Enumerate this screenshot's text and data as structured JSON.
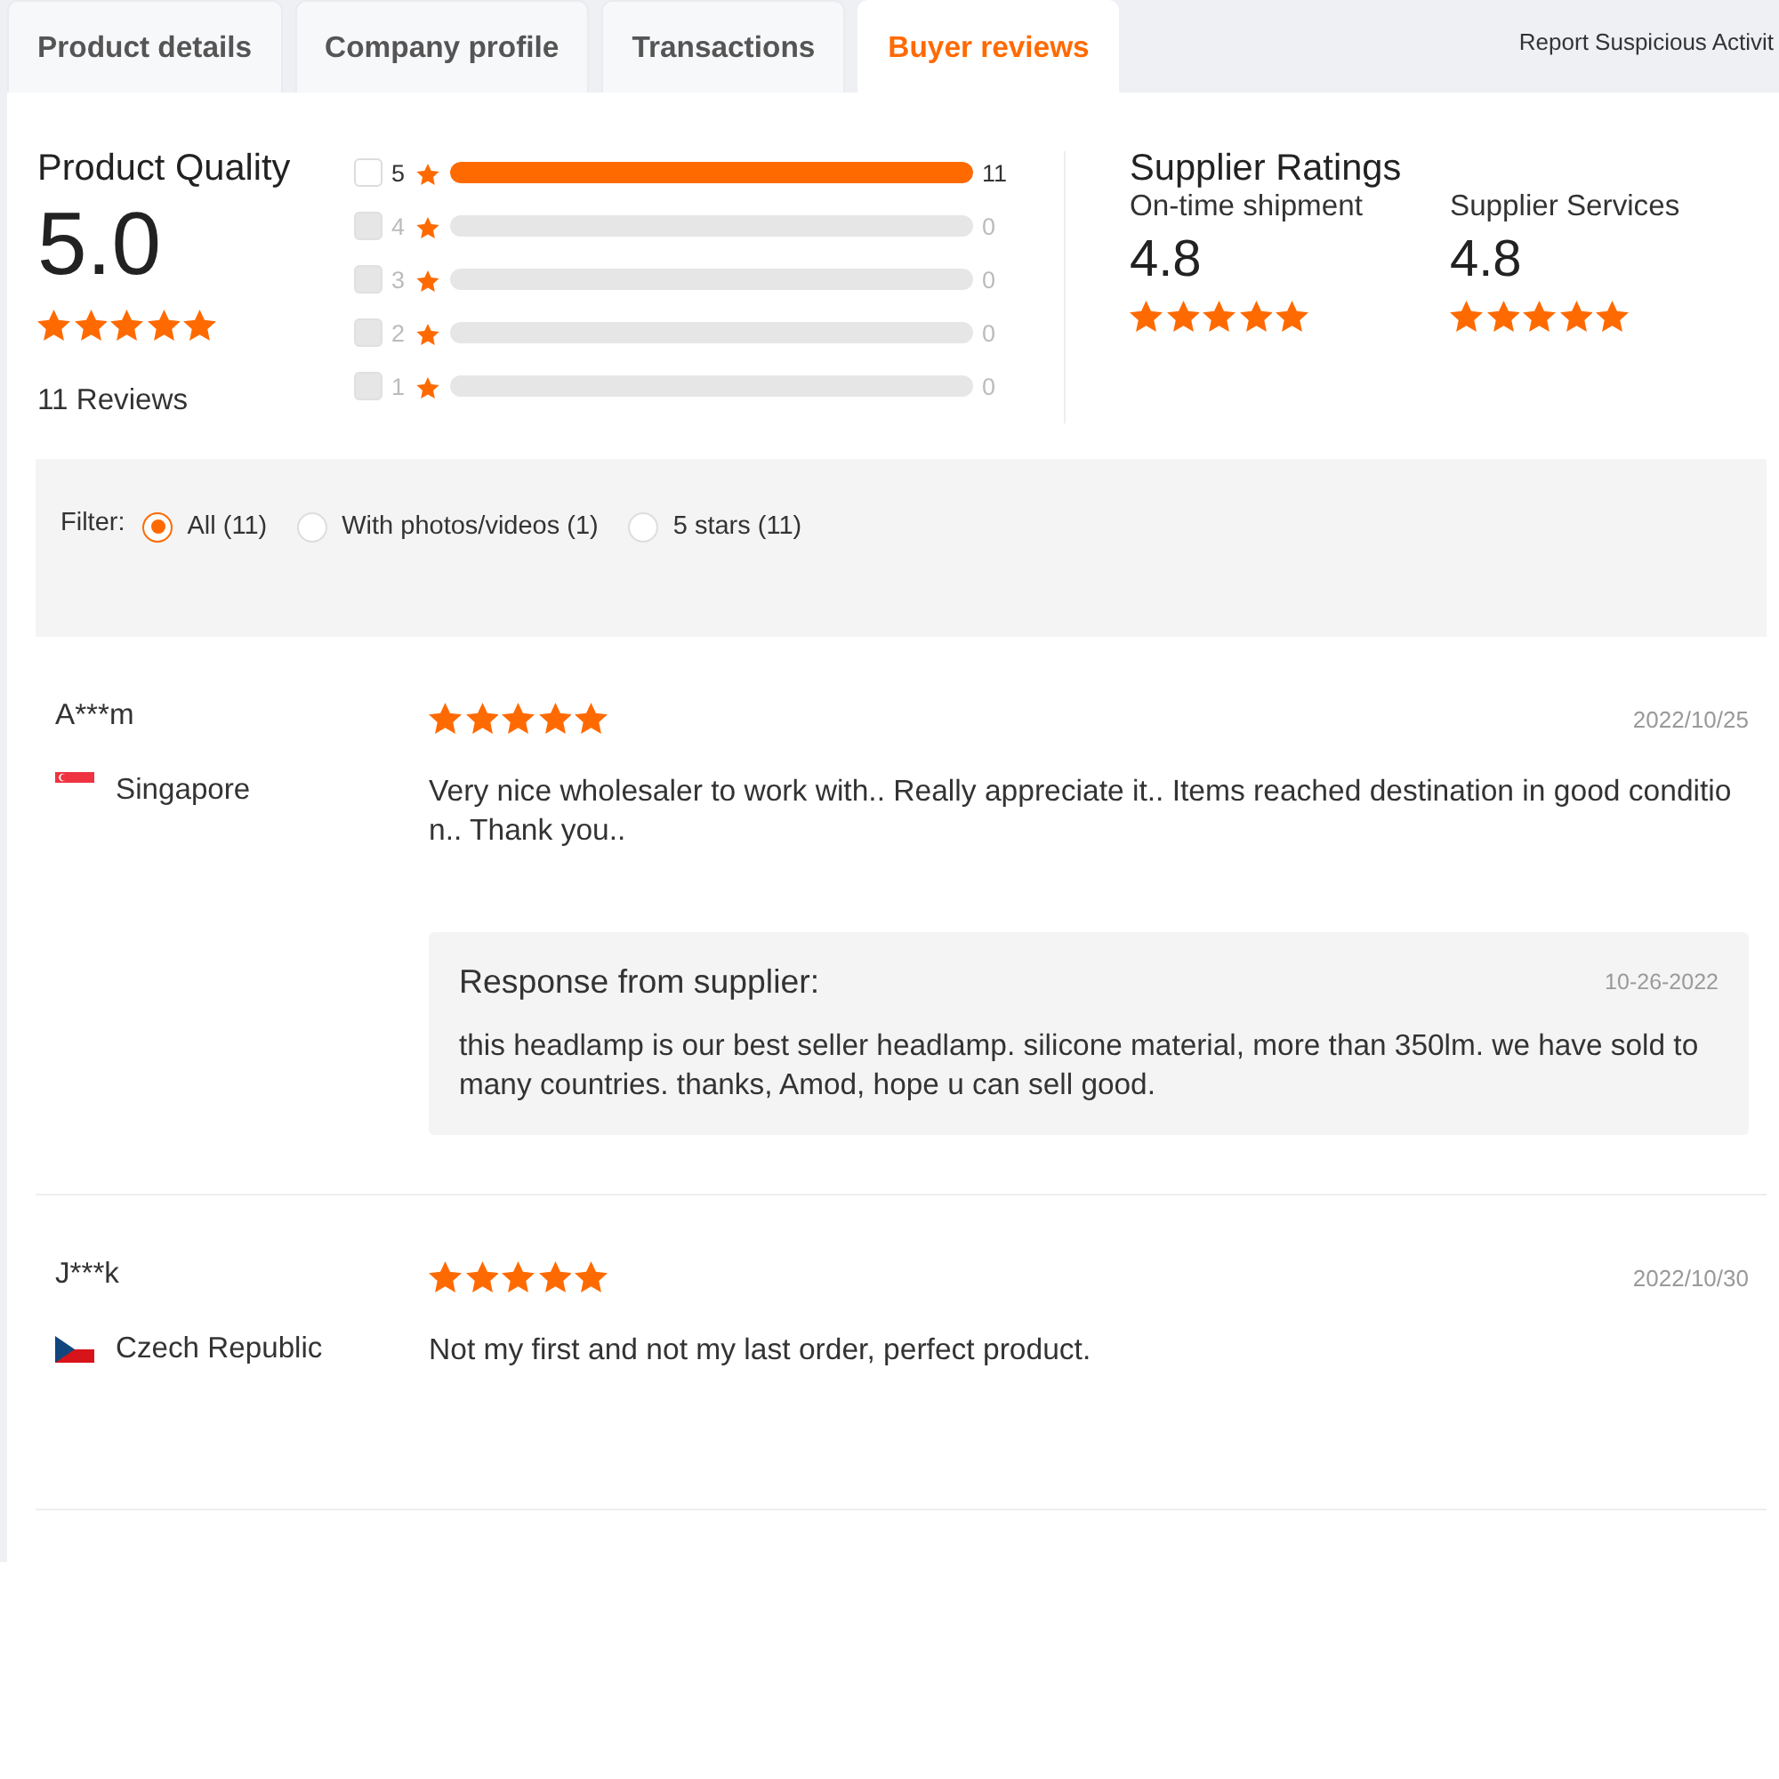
{
  "tabs": [
    {
      "label": "Product details",
      "selected": false
    },
    {
      "label": "Company profile",
      "selected": false
    },
    {
      "label": "Transactions",
      "selected": false
    },
    {
      "label": "Buyer reviews",
      "selected": true
    }
  ],
  "report_link": "Report Suspicious Activit",
  "quality": {
    "title": "Product Quality",
    "score": "5.0",
    "stars": 5,
    "reviews": "11 Reviews"
  },
  "breakdown": [
    {
      "label": "5",
      "count": "11",
      "level": 1,
      "disabled": false
    },
    {
      "label": "4",
      "count": "0",
      "level": 0,
      "disabled": true
    },
    {
      "label": "3",
      "count": "0",
      "level": 0,
      "disabled": true
    },
    {
      "label": "2",
      "count": "0",
      "level": 0,
      "disabled": true
    },
    {
      "label": "1",
      "count": "0",
      "level": 0,
      "disabled": true
    }
  ],
  "supplier": {
    "title": "Supplier Ratings",
    "metrics": [
      {
        "label": "On-time shipment",
        "score": "4.8",
        "stars": 5
      },
      {
        "label": "Supplier Services",
        "score": "4.8",
        "stars": 5
      }
    ]
  },
  "filter": {
    "label": "Filter:",
    "options": [
      {
        "label": "All (11)",
        "selected": true
      },
      {
        "label": "With photos/videos (1)",
        "selected": false
      },
      {
        "label": "5 stars (11)",
        "selected": false
      }
    ]
  },
  "reviews": [
    {
      "name": "A***m",
      "flag": {
        "kind": "singapore"
      },
      "country": "Singapore",
      "stars": 5,
      "date": "2022/10/25",
      "text": "Very nice wholesaler to work with.. Really appreciate it.. Items reached destination in good condition.. Thank you..",
      "response": {
        "title": "Response from supplier:",
        "date": "10-26-2022",
        "text": "this headlamp is our best seller headlamp. silicone material, more than 350lm. we have sold to many countries. thanks, Amod, hope u can sell good."
      }
    },
    {
      "name": "J***k",
      "flag": {
        "kind": "czech"
      },
      "country": "Czech Republic",
      "stars": 5,
      "date": "2022/10/30",
      "text": "Not my first and not my last order, perfect product."
    }
  ]
}
